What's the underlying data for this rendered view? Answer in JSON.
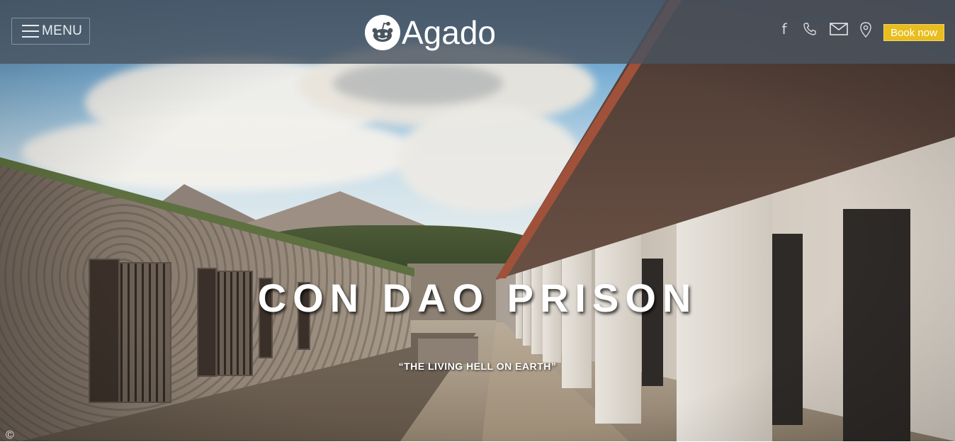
{
  "header": {
    "menu_label": "MENU",
    "logo_text": "Agado",
    "book_now_label": "Book now"
  },
  "social": {
    "facebook_glyph": "f",
    "icons": [
      "facebook-icon",
      "phone-icon",
      "mail-icon",
      "map-pin-icon"
    ]
  },
  "hero": {
    "title": "CON DAO PRISON",
    "subtitle": "“THE LIVING HELL ON EARTH”",
    "copyright_glyph": "©"
  },
  "colors": {
    "header_bg": "#4a5460",
    "accent": "#e8bd1d",
    "text": "#ffffff"
  }
}
